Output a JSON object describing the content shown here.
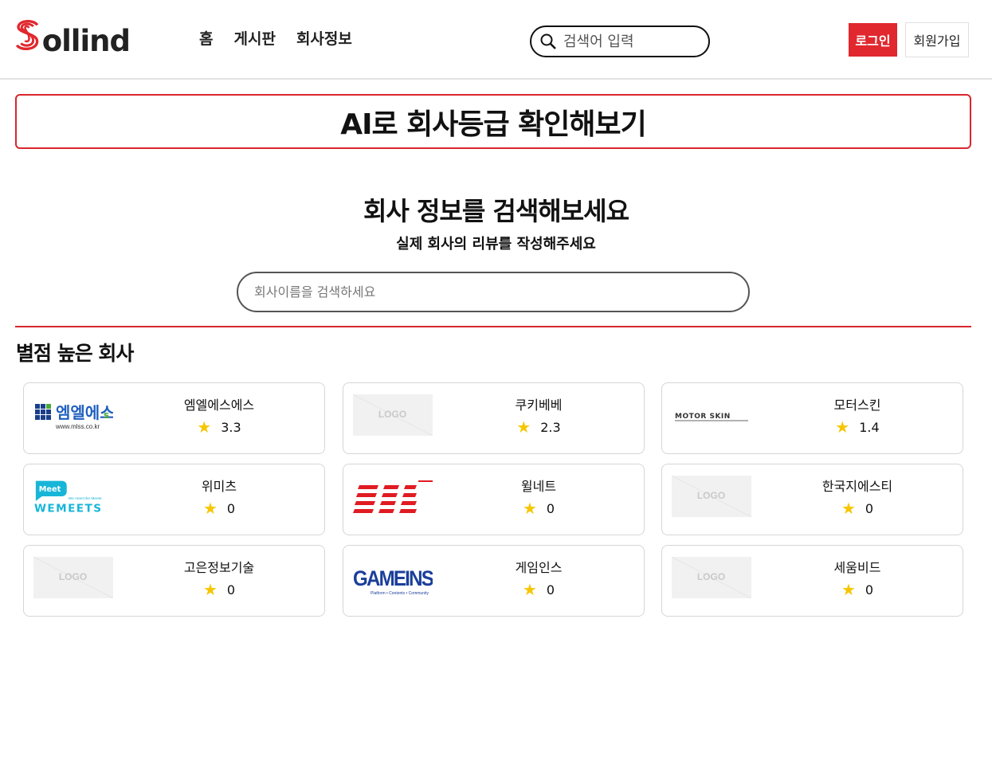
{
  "header": {
    "logo_text": "ollind",
    "nav": [
      "홈",
      "게시판",
      "회사정보"
    ],
    "search_placeholder": "검색어 입력",
    "login_label": "로그인",
    "signup_label": "회원가입"
  },
  "banner": {
    "text": "AI로 회사등급 확인해보기"
  },
  "hero": {
    "title": "회사 정보를 검색해보세요",
    "subtitle": "실제 회사의 리뷰를 작성해주세요",
    "search_placeholder": "회사이름을 검색하세요"
  },
  "section": {
    "title": "별점 높은 회사"
  },
  "companies": [
    {
      "name": "엠엘에스에스",
      "rating": "3.3",
      "logo": "mlss-logo",
      "logo_text": "엠엘에스",
      "logo_sub": "www.mlss.co.kr"
    },
    {
      "name": "쿠키베베",
      "rating": "2.3",
      "logo": "placeholder-logo",
      "logo_text": "LOGO"
    },
    {
      "name": "모터스킨",
      "rating": "1.4",
      "logo": "motorskin-logo",
      "logo_text": "MOTOR SKIN"
    },
    {
      "name": "위미츠",
      "rating": "0",
      "logo": "wemeets-logo",
      "logo_text": "WEMEETS",
      "logo_badge": "Meet",
      "logo_sub": "We meet the Meets"
    },
    {
      "name": "윌네트",
      "rating": "0",
      "logo": "willnet-logo"
    },
    {
      "name": "한국지에스티",
      "rating": "0",
      "logo": "placeholder-logo",
      "logo_text": "LOGO"
    },
    {
      "name": "고은정보기술",
      "rating": "0",
      "logo": "placeholder-logo",
      "logo_text": "LOGO"
    },
    {
      "name": "게임인스",
      "rating": "0",
      "logo": "gameins-logo",
      "logo_text": "GAMEINS",
      "logo_sub": "Platform • Contents • Community"
    },
    {
      "name": "세움비드",
      "rating": "0",
      "logo": "placeholder-logo",
      "logo_text": "LOGO"
    }
  ],
  "colors": {
    "accent": "#d9262c",
    "star": "#f6c600"
  }
}
